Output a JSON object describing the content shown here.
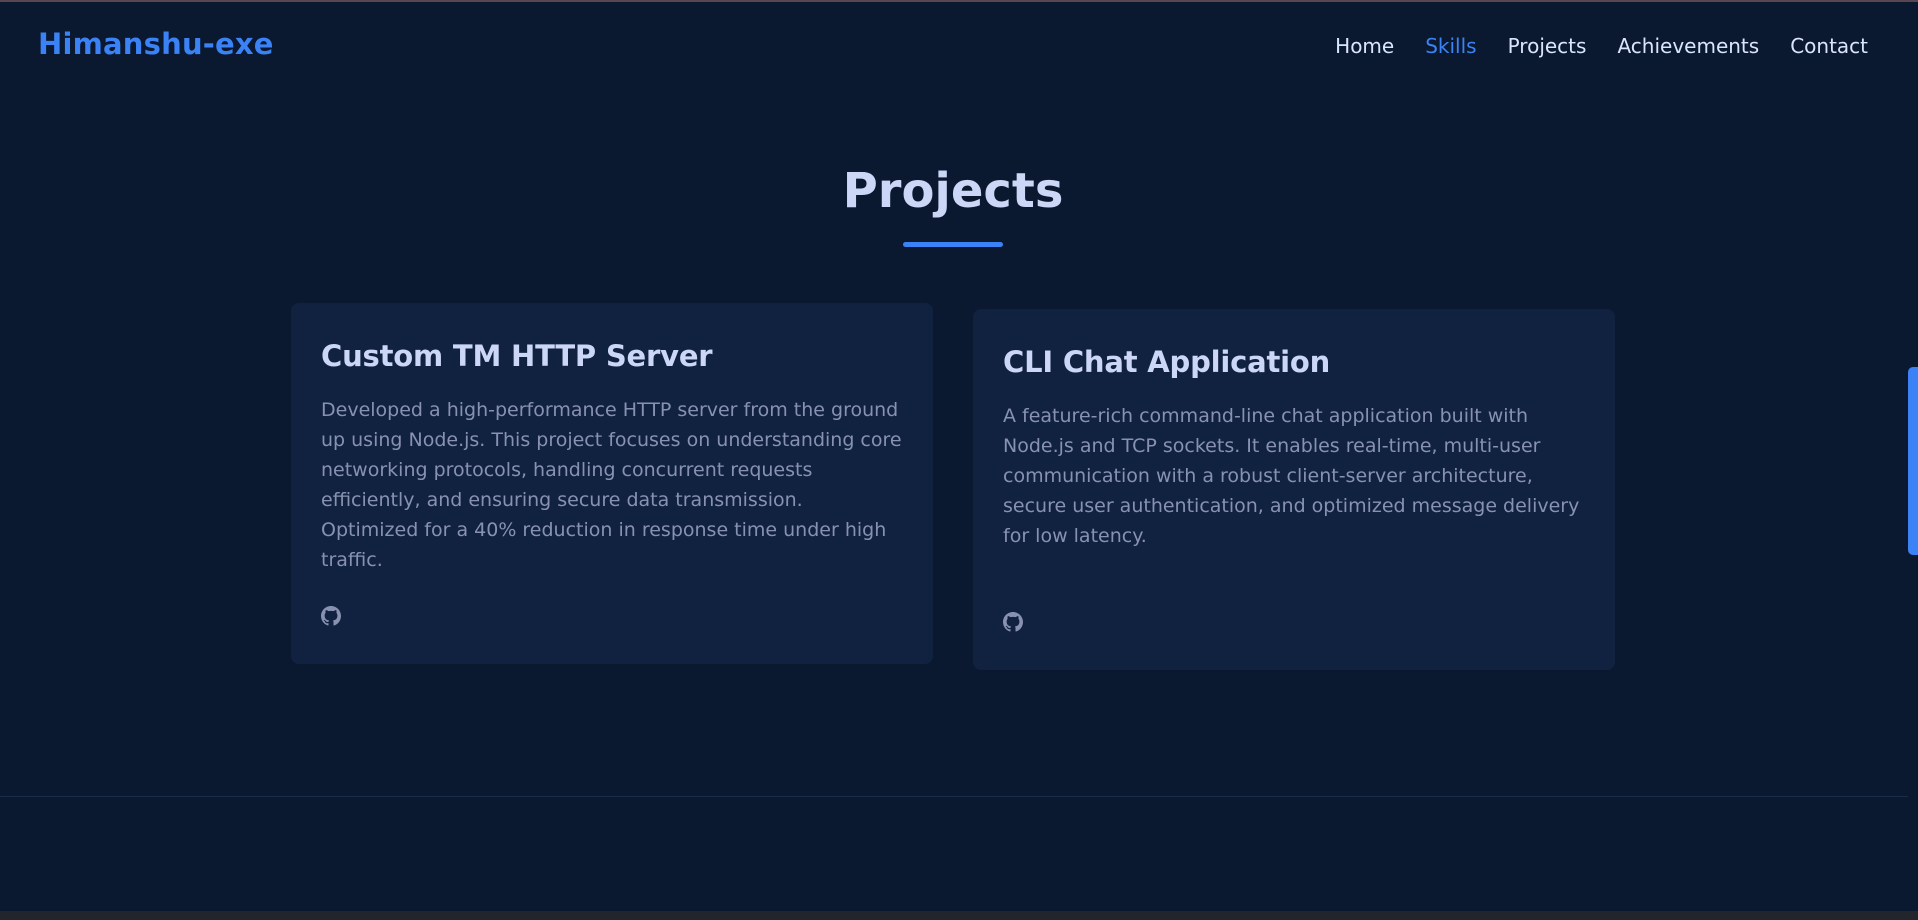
{
  "logo": "Himanshu-exe",
  "nav": {
    "items": [
      {
        "label": "Home",
        "active": false
      },
      {
        "label": "Skills",
        "active": true
      },
      {
        "label": "Projects",
        "active": false
      },
      {
        "label": "Achievements",
        "active": false
      },
      {
        "label": "Contact",
        "active": false
      }
    ]
  },
  "section": {
    "title": "Projects"
  },
  "projects": [
    {
      "title": "Custom TM HTTP Server",
      "description": "Developed a high-performance HTTP server from the ground up using Node.js. This project focuses on understanding core networking protocols, handling concurrent requests efficiently, and ensuring secure data transmission. Optimized for a 40% reduction in response time under high traffic.",
      "link_icon": "github-icon"
    },
    {
      "title": "CLI Chat Application",
      "description": "A feature-rich command-line chat application built with Node.js and TCP sockets. It enables real-time, multi-user communication with a robust client-server architecture, secure user authentication, and optimized message delivery for low latency.",
      "link_icon": "github-icon"
    }
  ],
  "colors": {
    "background": "#0a192f",
    "card": "#112240",
    "accent": "#3b82f6",
    "heading": "#ccd6f6",
    "text": "#8892b0"
  }
}
